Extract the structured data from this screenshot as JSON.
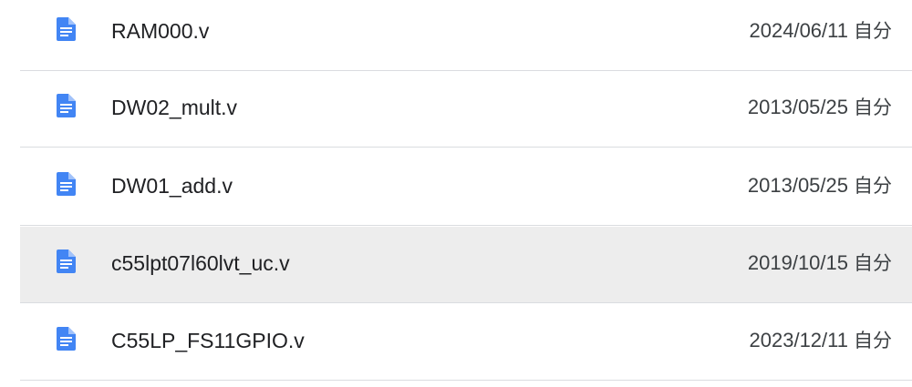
{
  "files": [
    {
      "name": "RAM000.v",
      "date": "2024/06/11",
      "owner": "自分",
      "icon": "doc-icon",
      "selected": false
    },
    {
      "name": "DW02_mult.v",
      "date": "2013/05/25",
      "owner": "自分",
      "icon": "doc-icon",
      "selected": false
    },
    {
      "name": "DW01_add.v",
      "date": "2013/05/25",
      "owner": "自分",
      "icon": "doc-icon",
      "selected": false
    },
    {
      "name": "c55lpt07l60lvt_uc.v",
      "date": "2019/10/15",
      "owner": "自分",
      "icon": "doc-icon",
      "selected": true
    },
    {
      "name": "C55LP_FS11GPIO.v",
      "date": "2023/12/11",
      "owner": "自分",
      "icon": "doc-icon",
      "selected": false
    }
  ],
  "colors": {
    "icon": "#4285f4",
    "selected_row": "#ededed",
    "divider": "#dadce0"
  }
}
